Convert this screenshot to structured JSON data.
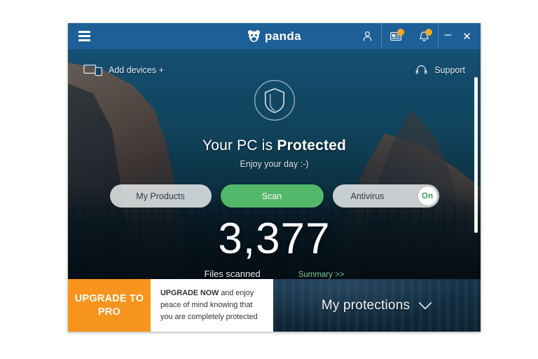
{
  "window": {
    "titlebar": {
      "menu_icon": "hamburger-icon",
      "brand_name": "panda",
      "brand_mark": "panda-head-icon",
      "account_icon": "person-icon",
      "news_icon": "news-card-icon",
      "notifications_icon": "bell-icon",
      "news_badge": "",
      "notifications_badge": "",
      "minimize_label": "–",
      "close_label": "✕"
    },
    "hero": {
      "add_devices_label": "Add devices +",
      "add_devices_icon": "devices-icon",
      "support_label": "Support",
      "support_icon": "headset-icon",
      "shield_icon": "shield-in-circle-icon",
      "status_prefix": "Your PC is ",
      "status_emphasis": "Protected",
      "status_sub": "Enjoy your day :-)",
      "buttons": {
        "my_products": "My Products",
        "scan": "Scan",
        "antivirus": "Antivirus",
        "antivirus_state": "On"
      },
      "counter_value": "3,377",
      "counter_label": "Files scanned",
      "summary_link": "Summary >>"
    },
    "bottom": {
      "upgrade_tag": "UPGRADE TO PRO",
      "upgrade_body_bold": "UPGRADE NOW",
      "upgrade_body_rest": " and enjoy peace of mind knowing that you are completely protected",
      "protections_label": "My protections",
      "protections_chevron": "chevron-down-icon"
    },
    "scrollbar": {
      "thumb": "vertical-scroll-thumb"
    }
  },
  "colors": {
    "titlebar_blue": "#1d6097",
    "scan_green": "#53b86a",
    "upgrade_orange": "#f7941d",
    "badge_orange": "#f5a623",
    "summary_green": "#7fc894"
  }
}
